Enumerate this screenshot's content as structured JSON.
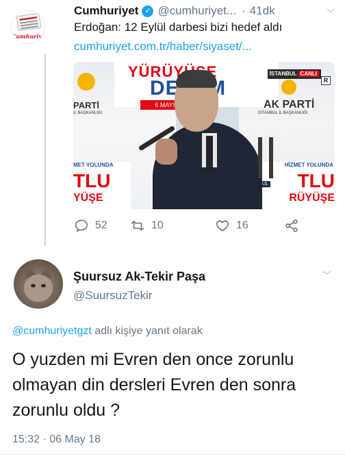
{
  "quoted_tweet": {
    "author_name": "Cumhuriyet",
    "handle": "@cumhuriyet",
    "handle_ellipsis": "...",
    "time_separator": "·",
    "time": "41dk",
    "avatar_brand": "Cumhuriyet",
    "text": "Erdoğan: 12 Eylül darbesi bizi hedef aldı",
    "link": "cumhuriyet.com.tr/haber/siyaset/...",
    "media": {
      "banner_top_1": "YÜRÜYÜŞE",
      "banner_top_2": "DEVAM",
      "date_strip": "6 MAYIS 2018",
      "party_left": "PARTİ",
      "party_left_sub": "İL BAŞKANLIĞI",
      "party_right": "AK PARTİ",
      "party_right_sub": "İSTANBUL İL BAŞKANLIĞI",
      "live_channel": "İSTANBUL",
      "live_label": "CANLI",
      "rating_box": "R",
      "bottom_left_1": "MET YOLUNDA",
      "bottom_left_2": "TLU",
      "bottom_left_3": "YÜŞE",
      "bottom_right_1": "HİZMET YOLUNDA",
      "bottom_right_2": "TLU",
      "bottom_right_3": "RÜYÜŞE",
      "istanbul_tag": "İSTANBUL"
    },
    "actions": {
      "reply_count": "52",
      "retweet_count": "10",
      "like_count": "16"
    }
  },
  "main_tweet": {
    "author_name": "Şuursuz Ak-Tekir Paşa",
    "handle": "@SuursuzTekir",
    "replying_mention": "@cumhuriyetgzt",
    "replying_text": " adlı kişiye yanıt olarak",
    "body": "O yuzden mi Evren den once zorunlu olmayan din dersleri Evren den sonra zorunlu oldu ?",
    "timestamp": "15:32 · 06 May 18"
  },
  "colors": {
    "accent": "#1da1f2",
    "secondary_text": "#657786",
    "primary_text": "#14171a"
  }
}
